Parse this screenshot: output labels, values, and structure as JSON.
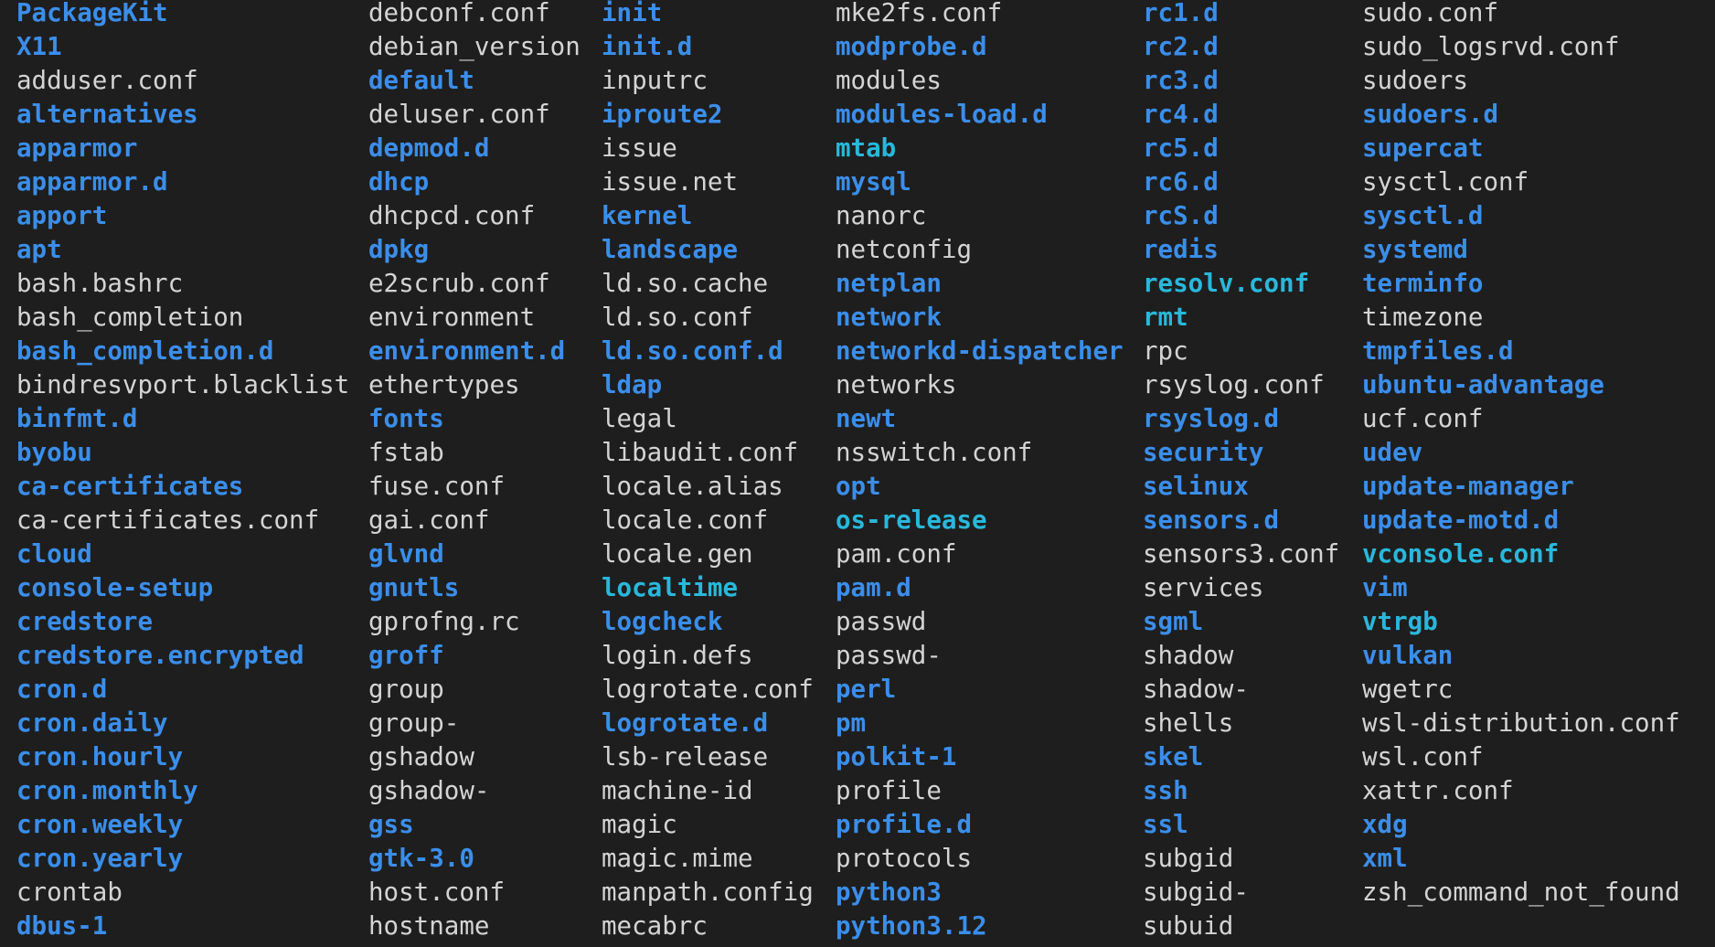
{
  "window": {
    "title": ""
  },
  "colors": {
    "background": "#1e1e1e",
    "file": "#d4d4d4",
    "dir": "#3b8eea",
    "link": "#29b8db"
  },
  "listing": {
    "columns": [
      [
        {
          "name": "PackageKit",
          "type": "dir"
        },
        {
          "name": "X11",
          "type": "dir"
        },
        {
          "name": "adduser.conf",
          "type": "file"
        },
        {
          "name": "alternatives",
          "type": "dir"
        },
        {
          "name": "apparmor",
          "type": "dir"
        },
        {
          "name": "apparmor.d",
          "type": "dir"
        },
        {
          "name": "apport",
          "type": "dir"
        },
        {
          "name": "apt",
          "type": "dir"
        },
        {
          "name": "bash.bashrc",
          "type": "file"
        },
        {
          "name": "bash_completion",
          "type": "file"
        },
        {
          "name": "bash_completion.d",
          "type": "dir"
        },
        {
          "name": "bindresvport.blacklist",
          "type": "file"
        },
        {
          "name": "binfmt.d",
          "type": "dir"
        },
        {
          "name": "byobu",
          "type": "dir"
        },
        {
          "name": "ca-certificates",
          "type": "dir"
        },
        {
          "name": "ca-certificates.conf",
          "type": "file"
        },
        {
          "name": "cloud",
          "type": "dir"
        },
        {
          "name": "console-setup",
          "type": "dir"
        },
        {
          "name": "credstore",
          "type": "dir"
        },
        {
          "name": "credstore.encrypted",
          "type": "dir"
        },
        {
          "name": "cron.d",
          "type": "dir"
        },
        {
          "name": "cron.daily",
          "type": "dir"
        },
        {
          "name": "cron.hourly",
          "type": "dir"
        },
        {
          "name": "cron.monthly",
          "type": "dir"
        },
        {
          "name": "cron.weekly",
          "type": "dir"
        },
        {
          "name": "cron.yearly",
          "type": "dir"
        },
        {
          "name": "crontab",
          "type": "file"
        },
        {
          "name": "dbus-1",
          "type": "dir"
        }
      ],
      [
        {
          "name": "debconf.conf",
          "type": "file"
        },
        {
          "name": "debian_version",
          "type": "file"
        },
        {
          "name": "default",
          "type": "dir"
        },
        {
          "name": "deluser.conf",
          "type": "file"
        },
        {
          "name": "depmod.d",
          "type": "dir"
        },
        {
          "name": "dhcp",
          "type": "dir"
        },
        {
          "name": "dhcpcd.conf",
          "type": "file"
        },
        {
          "name": "dpkg",
          "type": "dir"
        },
        {
          "name": "e2scrub.conf",
          "type": "file"
        },
        {
          "name": "environment",
          "type": "file"
        },
        {
          "name": "environment.d",
          "type": "dir"
        },
        {
          "name": "ethertypes",
          "type": "file"
        },
        {
          "name": "fonts",
          "type": "dir"
        },
        {
          "name": "fstab",
          "type": "file"
        },
        {
          "name": "fuse.conf",
          "type": "file"
        },
        {
          "name": "gai.conf",
          "type": "file"
        },
        {
          "name": "glvnd",
          "type": "dir"
        },
        {
          "name": "gnutls",
          "type": "dir"
        },
        {
          "name": "gprofng.rc",
          "type": "file"
        },
        {
          "name": "groff",
          "type": "dir"
        },
        {
          "name": "group",
          "type": "file"
        },
        {
          "name": "group-",
          "type": "file"
        },
        {
          "name": "gshadow",
          "type": "file"
        },
        {
          "name": "gshadow-",
          "type": "file"
        },
        {
          "name": "gss",
          "type": "dir"
        },
        {
          "name": "gtk-3.0",
          "type": "dir"
        },
        {
          "name": "host.conf",
          "type": "file"
        },
        {
          "name": "hostname",
          "type": "file"
        }
      ],
      [
        {
          "name": "init",
          "type": "dir"
        },
        {
          "name": "init.d",
          "type": "dir"
        },
        {
          "name": "inputrc",
          "type": "file"
        },
        {
          "name": "iproute2",
          "type": "dir"
        },
        {
          "name": "issue",
          "type": "file"
        },
        {
          "name": "issue.net",
          "type": "file"
        },
        {
          "name": "kernel",
          "type": "dir"
        },
        {
          "name": "landscape",
          "type": "dir"
        },
        {
          "name": "ld.so.cache",
          "type": "file"
        },
        {
          "name": "ld.so.conf",
          "type": "file"
        },
        {
          "name": "ld.so.conf.d",
          "type": "dir"
        },
        {
          "name": "ldap",
          "type": "dir"
        },
        {
          "name": "legal",
          "type": "file"
        },
        {
          "name": "libaudit.conf",
          "type": "file"
        },
        {
          "name": "locale.alias",
          "type": "file"
        },
        {
          "name": "locale.conf",
          "type": "file"
        },
        {
          "name": "locale.gen",
          "type": "file"
        },
        {
          "name": "localtime",
          "type": "link"
        },
        {
          "name": "logcheck",
          "type": "dir"
        },
        {
          "name": "login.defs",
          "type": "file"
        },
        {
          "name": "logrotate.conf",
          "type": "file"
        },
        {
          "name": "logrotate.d",
          "type": "dir"
        },
        {
          "name": "lsb-release",
          "type": "file"
        },
        {
          "name": "machine-id",
          "type": "file"
        },
        {
          "name": "magic",
          "type": "file"
        },
        {
          "name": "magic.mime",
          "type": "file"
        },
        {
          "name": "manpath.config",
          "type": "file"
        },
        {
          "name": "mecabrc",
          "type": "file"
        }
      ],
      [
        {
          "name": "mke2fs.conf",
          "type": "file"
        },
        {
          "name": "modprobe.d",
          "type": "dir"
        },
        {
          "name": "modules",
          "type": "file"
        },
        {
          "name": "modules-load.d",
          "type": "dir"
        },
        {
          "name": "mtab",
          "type": "link"
        },
        {
          "name": "mysql",
          "type": "dir"
        },
        {
          "name": "nanorc",
          "type": "file"
        },
        {
          "name": "netconfig",
          "type": "file"
        },
        {
          "name": "netplan",
          "type": "dir"
        },
        {
          "name": "network",
          "type": "dir"
        },
        {
          "name": "networkd-dispatcher",
          "type": "dir"
        },
        {
          "name": "networks",
          "type": "file"
        },
        {
          "name": "newt",
          "type": "dir"
        },
        {
          "name": "nsswitch.conf",
          "type": "file"
        },
        {
          "name": "opt",
          "type": "dir"
        },
        {
          "name": "os-release",
          "type": "link"
        },
        {
          "name": "pam.conf",
          "type": "file"
        },
        {
          "name": "pam.d",
          "type": "dir"
        },
        {
          "name": "passwd",
          "type": "file"
        },
        {
          "name": "passwd-",
          "type": "file"
        },
        {
          "name": "perl",
          "type": "dir"
        },
        {
          "name": "pm",
          "type": "dir"
        },
        {
          "name": "polkit-1",
          "type": "dir"
        },
        {
          "name": "profile",
          "type": "file"
        },
        {
          "name": "profile.d",
          "type": "dir"
        },
        {
          "name": "protocols",
          "type": "file"
        },
        {
          "name": "python3",
          "type": "dir"
        },
        {
          "name": "python3.12",
          "type": "dir"
        }
      ],
      [
        {
          "name": "rc1.d",
          "type": "dir"
        },
        {
          "name": "rc2.d",
          "type": "dir"
        },
        {
          "name": "rc3.d",
          "type": "dir"
        },
        {
          "name": "rc4.d",
          "type": "dir"
        },
        {
          "name": "rc5.d",
          "type": "dir"
        },
        {
          "name": "rc6.d",
          "type": "dir"
        },
        {
          "name": "rcS.d",
          "type": "dir"
        },
        {
          "name": "redis",
          "type": "dir"
        },
        {
          "name": "resolv.conf",
          "type": "link"
        },
        {
          "name": "rmt",
          "type": "link"
        },
        {
          "name": "rpc",
          "type": "file"
        },
        {
          "name": "rsyslog.conf",
          "type": "file"
        },
        {
          "name": "rsyslog.d",
          "type": "dir"
        },
        {
          "name": "security",
          "type": "dir"
        },
        {
          "name": "selinux",
          "type": "dir"
        },
        {
          "name": "sensors.d",
          "type": "dir"
        },
        {
          "name": "sensors3.conf",
          "type": "file"
        },
        {
          "name": "services",
          "type": "file"
        },
        {
          "name": "sgml",
          "type": "dir"
        },
        {
          "name": "shadow",
          "type": "file"
        },
        {
          "name": "shadow-",
          "type": "file"
        },
        {
          "name": "shells",
          "type": "file"
        },
        {
          "name": "skel",
          "type": "dir"
        },
        {
          "name": "ssh",
          "type": "dir"
        },
        {
          "name": "ssl",
          "type": "dir"
        },
        {
          "name": "subgid",
          "type": "file"
        },
        {
          "name": "subgid-",
          "type": "file"
        },
        {
          "name": "subuid",
          "type": "file"
        }
      ],
      [
        {
          "name": "sudo.conf",
          "type": "file"
        },
        {
          "name": "sudo_logsrvd.conf",
          "type": "file"
        },
        {
          "name": "sudoers",
          "type": "file"
        },
        {
          "name": "sudoers.d",
          "type": "dir"
        },
        {
          "name": "supercat",
          "type": "dir"
        },
        {
          "name": "sysctl.conf",
          "type": "file"
        },
        {
          "name": "sysctl.d",
          "type": "dir"
        },
        {
          "name": "systemd",
          "type": "dir"
        },
        {
          "name": "terminfo",
          "type": "dir"
        },
        {
          "name": "timezone",
          "type": "file"
        },
        {
          "name": "tmpfiles.d",
          "type": "dir"
        },
        {
          "name": "ubuntu-advantage",
          "type": "dir"
        },
        {
          "name": "ucf.conf",
          "type": "file"
        },
        {
          "name": "udev",
          "type": "dir"
        },
        {
          "name": "update-manager",
          "type": "dir"
        },
        {
          "name": "update-motd.d",
          "type": "dir"
        },
        {
          "name": "vconsole.conf",
          "type": "link"
        },
        {
          "name": "vim",
          "type": "dir"
        },
        {
          "name": "vtrgb",
          "type": "link"
        },
        {
          "name": "vulkan",
          "type": "dir"
        },
        {
          "name": "wgetrc",
          "type": "file"
        },
        {
          "name": "wsl-distribution.conf",
          "type": "file"
        },
        {
          "name": "wsl.conf",
          "type": "file"
        },
        {
          "name": "xattr.conf",
          "type": "file"
        },
        {
          "name": "xdg",
          "type": "dir"
        },
        {
          "name": "xml",
          "type": "dir"
        },
        {
          "name": "zsh_command_not_found",
          "type": "file"
        }
      ]
    ]
  }
}
